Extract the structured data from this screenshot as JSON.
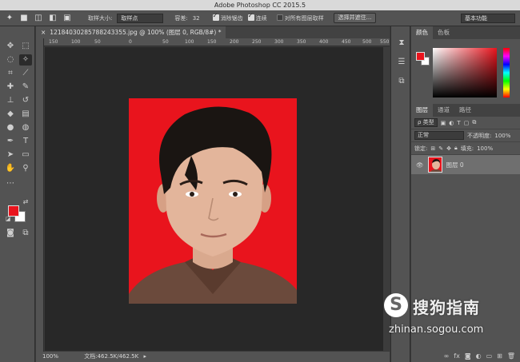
{
  "app": {
    "title": "Adobe Photoshop CC 2015.5"
  },
  "options": {
    "sample_size_label": "取样大小:",
    "sample_size_value": "取样点",
    "tolerance_label": "容差:",
    "tolerance_value": "32",
    "antialias_label": "消除锯齿",
    "contiguous_label": "连续",
    "sample_all_label": "对所有图层取样",
    "select_mask_button": "选择并遮住...",
    "workspace_value": "基本功能"
  },
  "document": {
    "tab_label": "12184030285788243355.jpg @ 100% (图层 0, RGB/8#) *",
    "ruler_ticks": [
      "150",
      "100",
      "50",
      "0",
      "50",
      "100",
      "150",
      "200",
      "250",
      "300",
      "350",
      "400",
      "450",
      "500",
      "550"
    ]
  },
  "status": {
    "zoom": "100%",
    "doc_info": "文档:462.5K/462.5K"
  },
  "color_panel": {
    "tabs": [
      "颜色",
      "色板"
    ]
  },
  "layers_panel": {
    "tabs": [
      "图层",
      "通道",
      "路径"
    ],
    "kind_filter": "ρ 类型",
    "blend_mode": "正常",
    "opacity_label": "不透明度:",
    "opacity_value": "100%",
    "lock_label": "锁定:",
    "fill_label": "填充:",
    "fill_value": "100%",
    "layer_name": "图层 0"
  },
  "watermark": {
    "brand": "搜狗指南",
    "url": "zhinan.sogou.com",
    "logo_letter": "S"
  },
  "colors": {
    "foreground": "#e9141d",
    "background": "#ffffff",
    "photo_bg": "#e9141d"
  }
}
